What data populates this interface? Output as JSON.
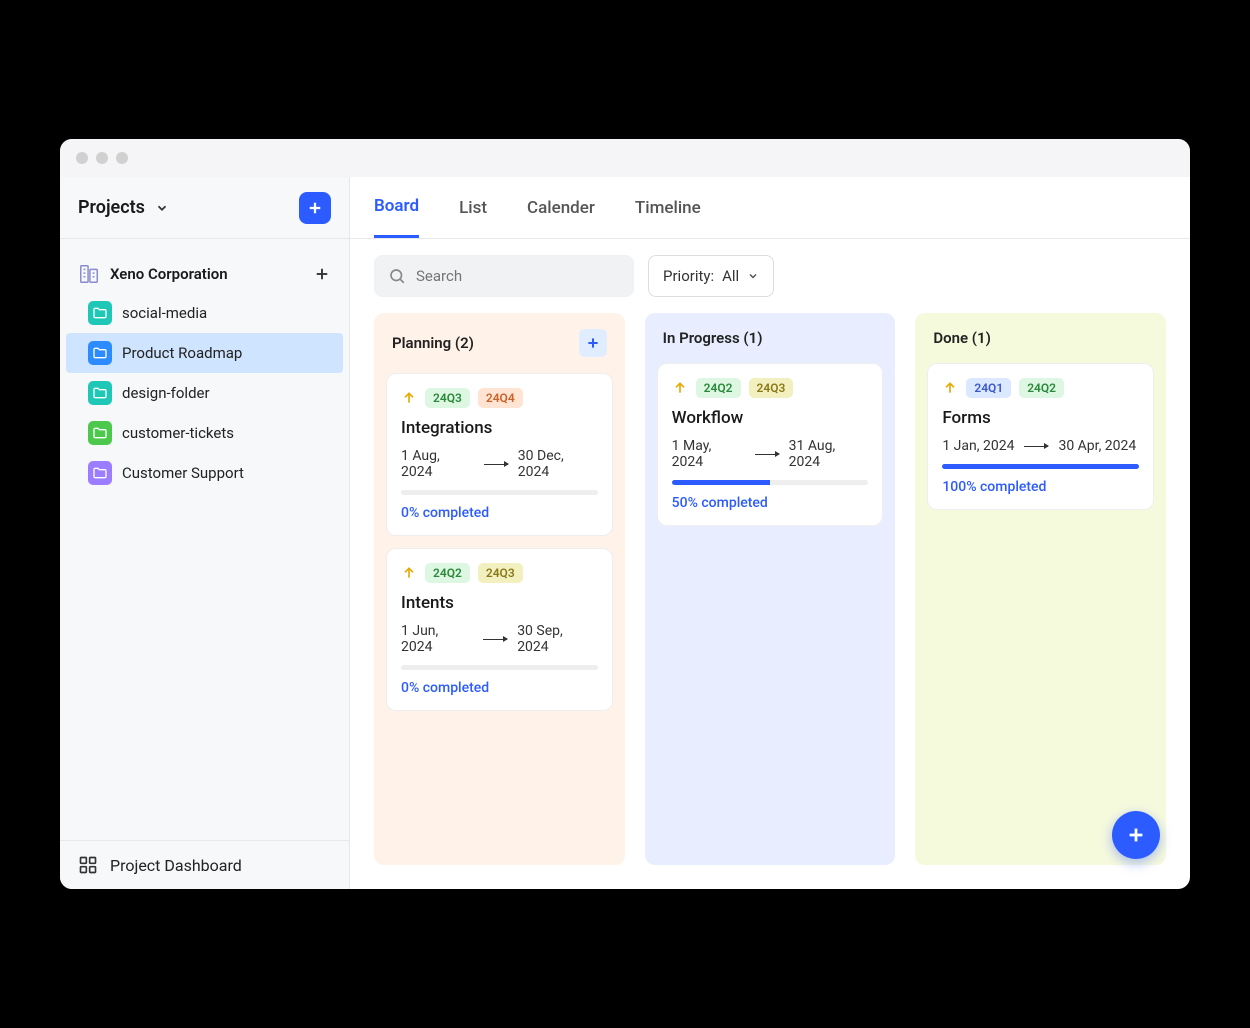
{
  "sidebar": {
    "header_label": "Projects",
    "org_name": "Xeno Corporation",
    "items": [
      {
        "label": "social-media",
        "icon": "folder-teal"
      },
      {
        "label": "Product Roadmap",
        "icon": "folder-blue",
        "active": true
      },
      {
        "label": "design-folder",
        "icon": "folder-teal"
      },
      {
        "label": "customer-tickets",
        "icon": "folder-green"
      },
      {
        "label": "Customer Support",
        "icon": "folder-purple"
      }
    ],
    "footer_label": "Project Dashboard"
  },
  "tabs": [
    {
      "label": "Board",
      "active": true
    },
    {
      "label": "List"
    },
    {
      "label": "Calender"
    },
    {
      "label": "Timeline"
    }
  ],
  "search": {
    "placeholder": "Search"
  },
  "priority": {
    "label": "Priority:",
    "value": "All"
  },
  "columns": [
    {
      "title": "Planning (2)",
      "theme": "planning",
      "show_add": true,
      "cards": [
        {
          "tags": [
            {
              "text": "24Q3",
              "cls": "tag-green"
            },
            {
              "text": "24Q4",
              "cls": "tag-orange"
            }
          ],
          "title": "Integrations",
          "start": "1 Aug, 2024",
          "end": "30 Dec, 2024",
          "progress": 0,
          "status": "0% completed"
        },
        {
          "tags": [
            {
              "text": "24Q2",
              "cls": "tag-green"
            },
            {
              "text": "24Q3",
              "cls": "tag-yellow"
            }
          ],
          "title": "Intents",
          "start": "1 Jun, 2024",
          "end": "30 Sep, 2024",
          "progress": 0,
          "status": "0% completed"
        }
      ]
    },
    {
      "title": "In Progress (1)",
      "theme": "progress",
      "show_add": false,
      "cards": [
        {
          "tags": [
            {
              "text": "24Q2",
              "cls": "tag-green"
            },
            {
              "text": "24Q3",
              "cls": "tag-yellow"
            }
          ],
          "title": "Workflow",
          "start": "1 May, 2024",
          "end": "31 Aug, 2024",
          "progress": 50,
          "status": "50% completed"
        }
      ]
    },
    {
      "title": "Done (1)",
      "theme": "done",
      "show_add": false,
      "cards": [
        {
          "tags": [
            {
              "text": "24Q1",
              "cls": "tag-blue"
            },
            {
              "text": "24Q2",
              "cls": "tag-green"
            }
          ],
          "title": "Forms",
          "start": "1 Jan, 2024",
          "end": "30 Apr, 2024",
          "progress": 100,
          "status": "100% completed"
        }
      ]
    }
  ]
}
